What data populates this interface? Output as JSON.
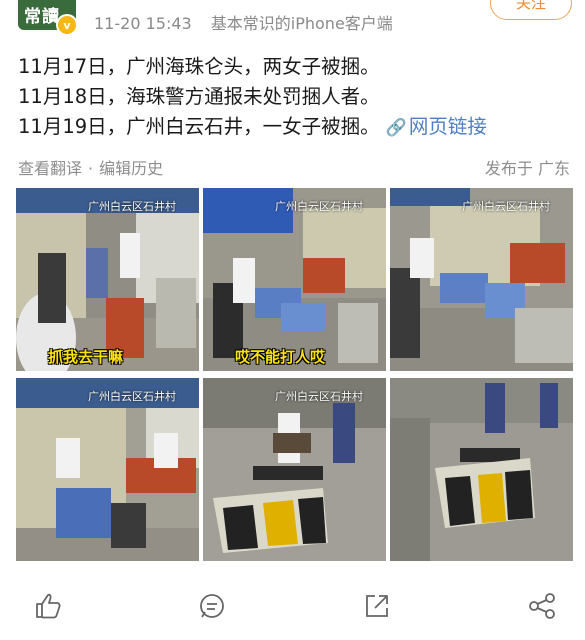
{
  "header": {
    "avatar_text": "常讀",
    "badge": "v",
    "time": "11-20 15:43",
    "source": "基本常识的iPhone客户端",
    "follow": "关注"
  },
  "post": {
    "lines": [
      "11月17日，广州海珠仑头，两女子被捆。",
      "11月18日，海珠警方通报未处罚捆人者。",
      "11月19日，广州白云石井，一女子被捆。"
    ],
    "link_label": "网页链接",
    "view_translation": "查看翻译",
    "edit_history": "编辑历史",
    "published": "发布于 广东"
  },
  "images": [
    {
      "watermark": "广州白云区石井村",
      "caption": "抓我去干嘛"
    },
    {
      "watermark": "广州白云区石井村",
      "caption": "哎不能打人哎"
    },
    {
      "watermark": "广州白云区石井村",
      "caption": ""
    },
    {
      "watermark": "广州白云区石井村",
      "caption": ""
    },
    {
      "watermark": "广州白云区石井村",
      "caption": ""
    },
    {
      "watermark": "",
      "caption": ""
    }
  ],
  "colors": {
    "accent": "#f08a2c",
    "link": "#4f7fc2",
    "meta": "#8a8a8a"
  },
  "actions": [
    "like-icon",
    "comment-icon",
    "share-icon",
    "more-share-icon"
  ]
}
